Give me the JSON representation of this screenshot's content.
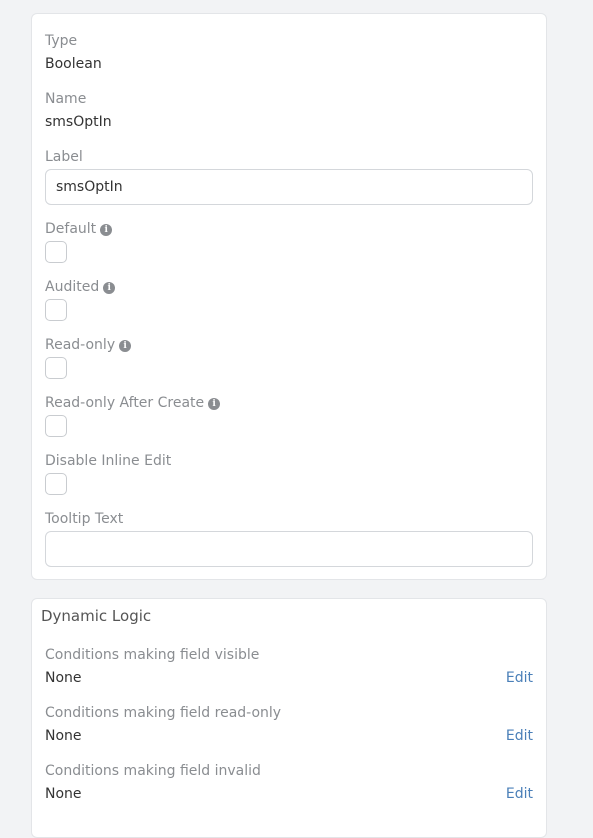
{
  "fields_panel": {
    "type": {
      "label": "Type",
      "value": "Boolean"
    },
    "name": {
      "label": "Name",
      "value": "smsOptIn"
    },
    "label_field": {
      "label": "Label",
      "value": "smsOptIn"
    },
    "default": {
      "label": "Default",
      "checked": false
    },
    "audited": {
      "label": "Audited",
      "checked": false
    },
    "read_only": {
      "label": "Read-only",
      "checked": false
    },
    "read_only_after_create": {
      "label": "Read-only After Create",
      "checked": false
    },
    "disable_inline_edit": {
      "label": "Disable Inline Edit",
      "checked": false
    },
    "tooltip_text": {
      "label": "Tooltip Text",
      "value": ""
    },
    "info_icon_glyph": "i"
  },
  "dynamic_logic": {
    "title": "Dynamic Logic",
    "rows": [
      {
        "label": "Conditions making field visible",
        "value": "None",
        "action": "Edit"
      },
      {
        "label": "Conditions making field read-only",
        "value": "None",
        "action": "Edit"
      },
      {
        "label": "Conditions making field invalid",
        "value": "None",
        "action": "Edit"
      }
    ]
  },
  "colors": {
    "background": "#f2f3f5",
    "panel": "#ffffff",
    "label": "#8a8d91",
    "text": "#333333",
    "link": "#4a7fb8"
  }
}
